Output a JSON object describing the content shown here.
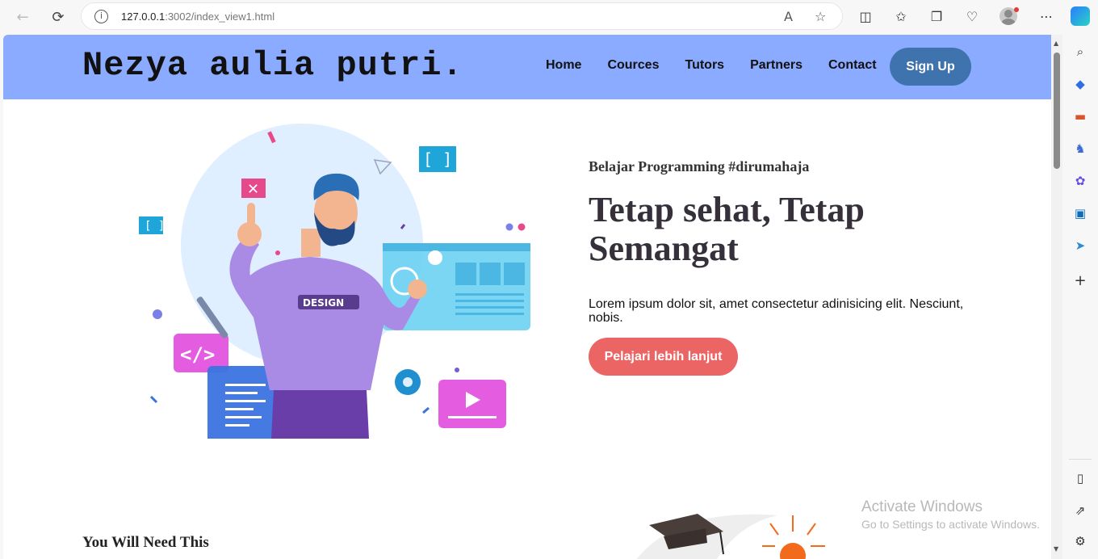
{
  "browser": {
    "url_host": "127.0.0.1",
    "url_rest": ":3002/index_view1.html"
  },
  "header": {
    "brand": "Nezya aulia putri.",
    "menu": [
      "Home",
      "Cources",
      "Tutors",
      "Partners",
      "Contact"
    ],
    "signup": "Sign Up"
  },
  "hero": {
    "eyebrow": "Belajar Programming #dirumahaja",
    "title": "Tetap sehat, Tetap Semangat",
    "description": "Lorem ipsum dolor sit, amet consectetur adinisicing elit. Nesciunt, nobis.",
    "cta": "Pelajari lebih lanjut",
    "art_badge": "DESIGN"
  },
  "section": {
    "title": "You Will Need This"
  },
  "watermark": {
    "line1": "Activate Windows",
    "line2": "Go to Settings to activate Windows."
  },
  "colors": {
    "header_bg": "#8aabff",
    "signup_bg": "#3f73ae",
    "cta_bg": "#ec6565"
  }
}
